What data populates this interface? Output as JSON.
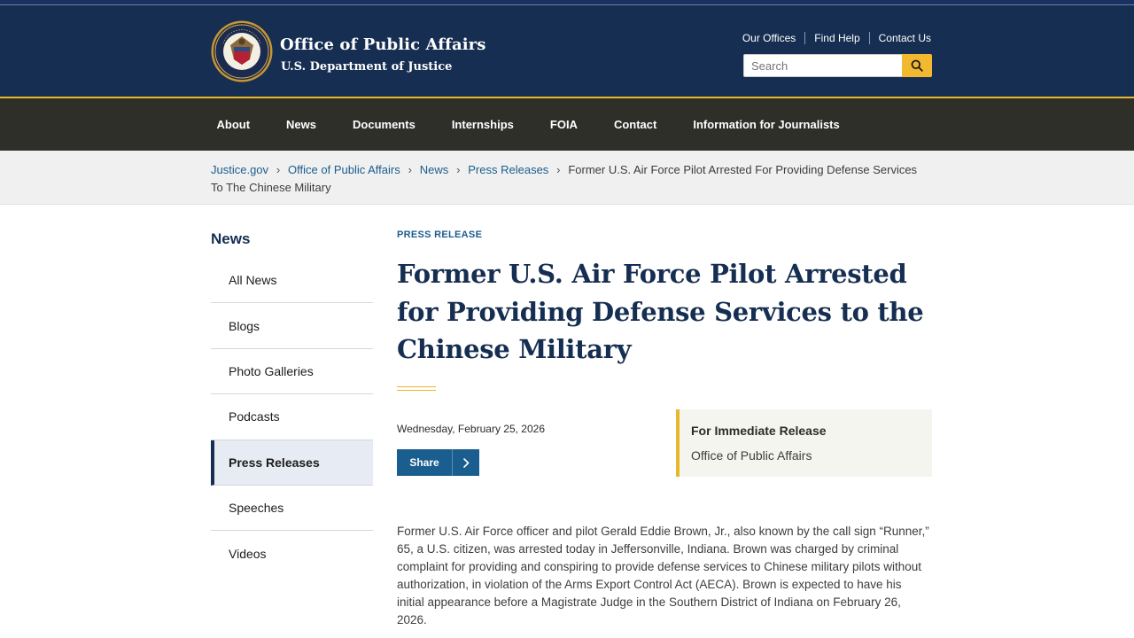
{
  "header": {
    "title": "Office of Public Affairs",
    "subtitle": "U.S. Department of Justice",
    "utility_links": [
      "Our Offices",
      "Find Help",
      "Contact Us"
    ],
    "search": {
      "placeholder": "Search"
    },
    "colors": {
      "navy": "#162e51",
      "gold": "#e6b82e",
      "nav_bg": "#2f2f2a",
      "link": "#1a5d8f"
    }
  },
  "main_nav": {
    "items": [
      "About",
      "News",
      "Documents",
      "Internships",
      "FOIA",
      "Contact",
      "Information for Journalists"
    ]
  },
  "breadcrumb": {
    "links": [
      "Justice.gov",
      "Office of Public Affairs",
      "News",
      "Press Releases"
    ],
    "current": "Former U.S. Air Force Pilot Arrested For Providing Defense Services To The Chinese Military"
  },
  "sidebar": {
    "title": "News",
    "items": [
      "All News",
      "Blogs",
      "Photo Galleries",
      "Podcasts",
      "Press Releases",
      "Speeches",
      "Videos"
    ],
    "active": "Press Releases"
  },
  "article": {
    "eyebrow": "PRESS RELEASE",
    "title": "Former U.S. Air Force Pilot Arrested for Providing Defense Services to the Chinese Military",
    "date": "Wednesday, February 25, 2026",
    "share_label": "Share",
    "release": {
      "title": "For Immediate Release",
      "office": "Office of Public Affairs"
    },
    "body": "Former U.S. Air Force officer and pilot Gerald Eddie Brown, Jr., also known by the call sign “Runner,” 65, a U.S. citizen, was arrested today in Jeffersonville, Indiana. Brown was charged by criminal complaint for providing and conspiring to provide defense services to Chinese military pilots without authorization, in violation of the Arms Export Control Act (AECA). Brown is expected to have his initial appearance before a Magistrate Judge in the Southern District of Indiana on February 26, 2026."
  },
  "icons": {
    "seal": "doj-seal-icon",
    "search": "search-icon",
    "breadcrumb_separator": "chevron-right-icon",
    "share": "chevron-right-icon"
  }
}
